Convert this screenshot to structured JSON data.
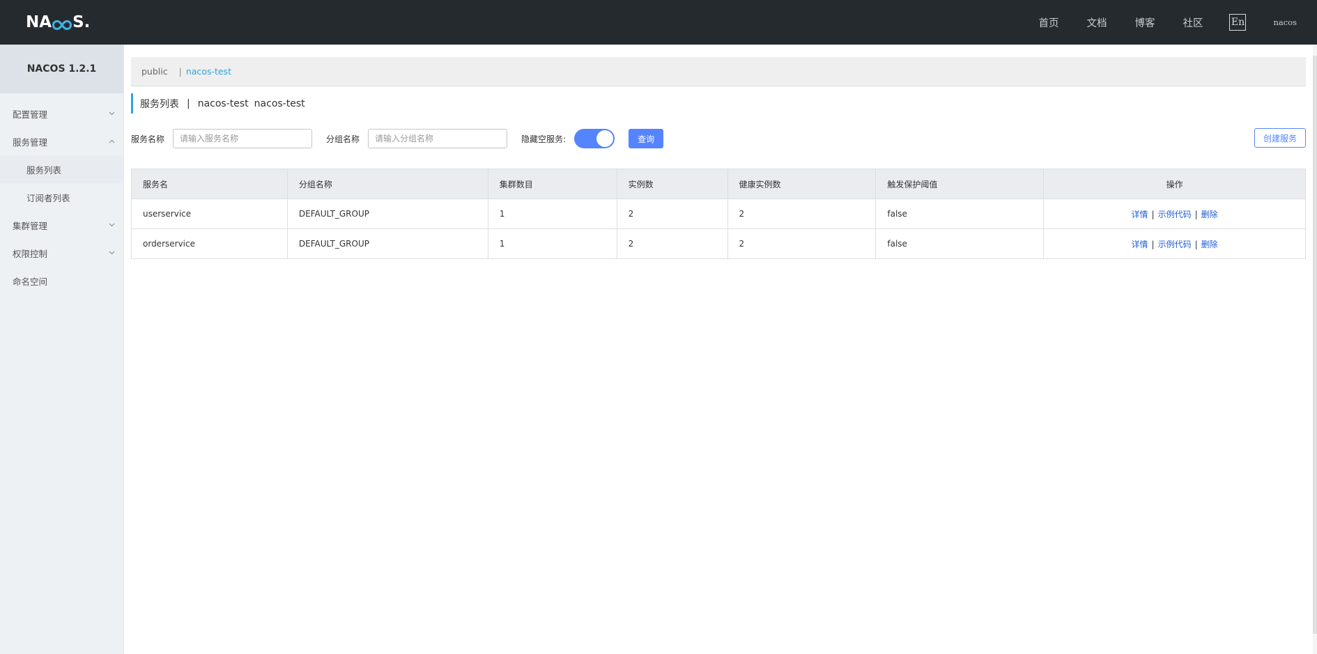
{
  "header": {
    "logo_text": "NACOS",
    "nav": [
      "首页",
      "文档",
      "博客",
      "社区"
    ],
    "lang_label": "En",
    "user": "nacos"
  },
  "sidebar": {
    "version": "NACOS 1.2.1",
    "items": [
      {
        "label": "配置管理",
        "expanded": false
      },
      {
        "label": "服务管理",
        "expanded": true
      },
      {
        "label": "服务列表"
      },
      {
        "label": "订阅者列表"
      },
      {
        "label": "集群管理",
        "expanded": false
      },
      {
        "label": "权限控制",
        "expanded": false
      },
      {
        "label": "命名空间"
      }
    ]
  },
  "namespaces": {
    "items": [
      "public",
      "nacos-test"
    ],
    "separator": "|",
    "active": "nacos-test"
  },
  "page": {
    "title": "服务列表",
    "separator": "|",
    "namespace_name": "nacos-test",
    "namespace_id": "nacos-test"
  },
  "filters": {
    "service_name_label": "服务名称",
    "service_name_placeholder": "请输入服务名称",
    "group_name_label": "分组名称",
    "group_name_placeholder": "请输入分组名称",
    "hide_empty_label": "隐藏空服务:",
    "hide_empty_on": true,
    "query_button": "查询",
    "create_button": "创建服务"
  },
  "table": {
    "columns": [
      "服务名",
      "分组名称",
      "集群数目",
      "实例数",
      "健康实例数",
      "触发保护阈值",
      "操作"
    ],
    "rows": [
      {
        "name": "userservice",
        "group": "DEFAULT_GROUP",
        "clusters": "1",
        "instances": "2",
        "healthy": "2",
        "protect": "false"
      },
      {
        "name": "orderservice",
        "group": "DEFAULT_GROUP",
        "clusters": "1",
        "instances": "2",
        "healthy": "2",
        "protect": "false"
      }
    ],
    "actions": {
      "detail": "详情",
      "sample": "示例代码",
      "delete": "删除",
      "sep": "|"
    }
  },
  "colors": {
    "topbar": "#252a2f",
    "primary": "#5584ff",
    "accent": "#2aa4d8",
    "link": "#2160d3"
  }
}
